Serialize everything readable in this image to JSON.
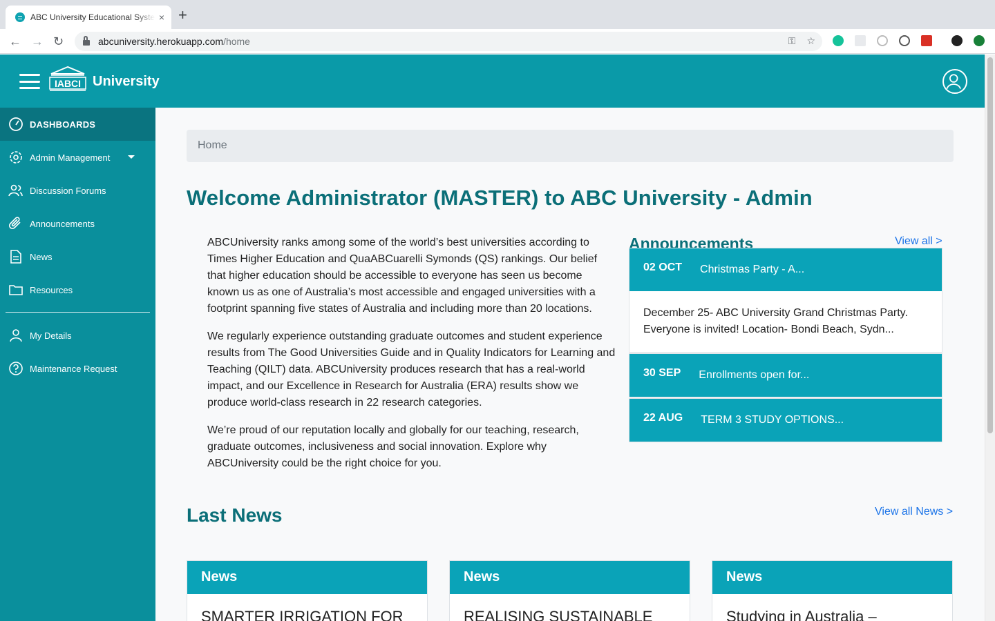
{
  "browser": {
    "tab_title": "ABC University Educational System",
    "tab_close": "×",
    "new_tab": "+",
    "back": "←",
    "forward": "→",
    "reload": "↻",
    "url_host": "abcuniversity.herokuapp.com",
    "url_path": "/home",
    "omni_key": "⚿",
    "omni_star": "☆"
  },
  "header": {
    "logo_text": "IABCI",
    "brand": "University"
  },
  "sidebar": {
    "items": [
      {
        "label": "DASHBOARDS",
        "icon": "gauge-icon"
      },
      {
        "label": "Admin Management",
        "icon": "gear-icon"
      },
      {
        "label": "Discussion Forums",
        "icon": "users-icon"
      },
      {
        "label": "Announcements",
        "icon": "paperclip-icon"
      },
      {
        "label": "News",
        "icon": "document-icon"
      },
      {
        "label": "Resources",
        "icon": "folder-icon"
      },
      {
        "label": "My Details",
        "icon": "user-icon"
      },
      {
        "label": "Maintenance Request",
        "icon": "help-icon"
      }
    ]
  },
  "breadcrumb": "Home",
  "welcome": "Welcome Administrator (MASTER) to ABC University - Admin",
  "intro": {
    "p1": "ABCUniversity ranks among some of the world’s best universities according to Times Higher Education and QuaABCuarelli Symonds (QS) rankings. Our belief that higher education should be accessible to everyone has seen us become known us as one of Australia’s most accessible and engaged universities with a footprint spanning five states of Australia and including more than 20 locations.",
    "p2": "We regularly experience outstanding graduate outcomes and student experience results from The Good Universities Guide and in Quality Indicators for Learning and Teaching (QILT) data. ABCUniversity produces research that has a real-world impact, and our Excellence in Research for Australia (ERA) results show we produce world-class research in 22 research categories.",
    "p3": "We’re proud of our reputation locally and globally for our teaching, research, graduate outcomes, inclusiveness and social innovation. Explore why ABCUniversity could be the right choice for you."
  },
  "announcements": {
    "title": "Announcements",
    "view_all": "View all >",
    "items": [
      {
        "date": "02 OCT",
        "heading": "Christmas Party - A...",
        "body": "December 25- ABC University Grand Christmas Party. Everyone is invited! Location- Bondi Beach, Sydn..."
      },
      {
        "date": "30 SEP",
        "heading": "Enrollments open for..."
      },
      {
        "date": "22 AUG",
        "heading": "TERM 3 STUDY OPTIONS..."
      }
    ]
  },
  "news": {
    "title": "Last News",
    "view_all": "View all News >",
    "cards": [
      {
        "label": "News",
        "title": "SMARTER IRRIGATION FOR"
      },
      {
        "label": "News",
        "title": "REALISING SUSTAINABLE"
      },
      {
        "label": "News",
        "title": "Studying in Australia –"
      }
    ]
  },
  "colors": {
    "header": "#0a9aa8",
    "sidebar": "#0a8f9c",
    "sidebar_active": "#0a7480",
    "card_header": "#0aa3b8",
    "heading_text": "#0b6f78",
    "link": "#1a73e8"
  }
}
